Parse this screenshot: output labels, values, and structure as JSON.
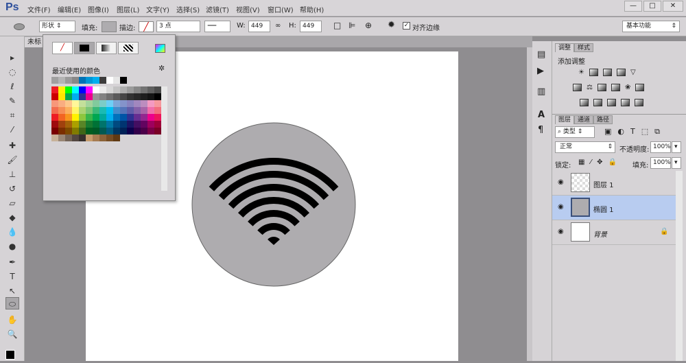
{
  "app": {
    "logo": "Ps"
  },
  "menu": [
    "文件(F)",
    "编辑(E)",
    "图像(I)",
    "图层(L)",
    "文字(Y)",
    "选择(S)",
    "滤镜(T)",
    "视图(V)",
    "窗口(W)",
    "帮助(H)"
  ],
  "window_controls": [
    "—",
    "□",
    "✕"
  ],
  "options": {
    "mode": "形状",
    "fill_label": "填充:",
    "stroke_label": "描边:",
    "stroke_width": "3 点",
    "w_label": "W:",
    "w_value": "449 像素",
    "h_label": "H:",
    "h_value": "449 像素",
    "align_edges": "对齐边缘",
    "align_checked": true,
    "workspace": "基本功能"
  },
  "document": {
    "tab": "未标"
  },
  "shape": {
    "fill": "#aeacaf",
    "icon": "wifi-icon",
    "icon_color": "#000000"
  },
  "popup": {
    "recent_label": "最近使用的颜色",
    "recent": [
      "#a0a0a0",
      "#b4b4b4",
      "#9a9a9a",
      "#888888",
      "#0072b5",
      "#0096d6",
      "#00aeef",
      "#3c3c3c",
      "#ffffff",
      "#e6e6e6",
      "#000000"
    ],
    "swatches": [
      "#ed1c24",
      "#fff200",
      "#00ff00",
      "#00ffff",
      "#0000ff",
      "#ff00ff",
      "#ffffff",
      "#ebebeb",
      "#d7d7d7",
      "#c3c3c3",
      "#afafaf",
      "#9b9b9b",
      "#878787",
      "#737373",
      "#5f5f5f",
      "#4b4b4b",
      "#cc0000",
      "#ffe600",
      "#00a651",
      "#00aeef",
      "#2e3192",
      "#ec008c",
      "#969696",
      "#828282",
      "#6e6e6e",
      "#5a5a5a",
      "#464646",
      "#323232",
      "#282828",
      "#1e1e1e",
      "#141414",
      "#000000",
      "#f7977a",
      "#f9ad81",
      "#fdc68a",
      "#fff79a",
      "#c4df9b",
      "#a3d39c",
      "#82ca9d",
      "#7bcdc8",
      "#6ecff6",
      "#7ea7d8",
      "#8493ca",
      "#8882be",
      "#a187be",
      "#bc8dbf",
      "#f49ac2",
      "#f6989d",
      "#f26c4f",
      "#f68e56",
      "#fbaf5d",
      "#fff568",
      "#acd373",
      "#7cc576",
      "#3bb878",
      "#1abbb4",
      "#00bff3",
      "#438ccb",
      "#5574b9",
      "#605ca8",
      "#8560a8",
      "#a864a8",
      "#f06eaa",
      "#f26d7d",
      "#ed1c24",
      "#f26522",
      "#f7941d",
      "#fff200",
      "#8dc63f",
      "#39b54a",
      "#00a651",
      "#00a99d",
      "#00aeef",
      "#0072bc",
      "#0054a6",
      "#2e3192",
      "#662d91",
      "#92278f",
      "#ec008c",
      "#ed145b",
      "#9e0b0f",
      "#a0410d",
      "#a36209",
      "#aba000",
      "#598527",
      "#197b30",
      "#007236",
      "#00746b",
      "#0076a3",
      "#004a80",
      "#003471",
      "#1b1464",
      "#440e62",
      "#630460",
      "#9e005d",
      "#9e0039",
      "#790000",
      "#7b2e00",
      "#7d4900",
      "#827b00",
      "#406618",
      "#005e20",
      "#005826",
      "#005952",
      "#005b7f",
      "#003663",
      "#002157",
      "#0d004c",
      "#32004b",
      "#4b0049",
      "#7b0046",
      "#7a0026",
      "#c7b299",
      "#998675",
      "#736357",
      "#534741",
      "#37302d",
      "#c69c6d",
      "#a67c52",
      "#8c6239",
      "#754c24",
      "#603913"
    ]
  },
  "strip_icons": [
    "history-icon",
    "play-icon",
    "properties-icon",
    "character-icon",
    "paragraph-icon"
  ],
  "adjustments": {
    "tabs": [
      "调整",
      "样式"
    ],
    "title": "添加调整"
  },
  "layers": {
    "tabs": [
      "图层",
      "通道",
      "路径"
    ],
    "filter": "类型",
    "blend": "正常",
    "opacity_label": "不透明度:",
    "opacity": "100%",
    "lock_label": "锁定:",
    "fill_label": "填充:",
    "fill": "100%",
    "items": [
      {
        "name": "图层 1",
        "selected": false
      },
      {
        "name": "椭圆 1",
        "selected": true
      },
      {
        "name": "背景",
        "selected": false,
        "locked": true
      }
    ]
  }
}
